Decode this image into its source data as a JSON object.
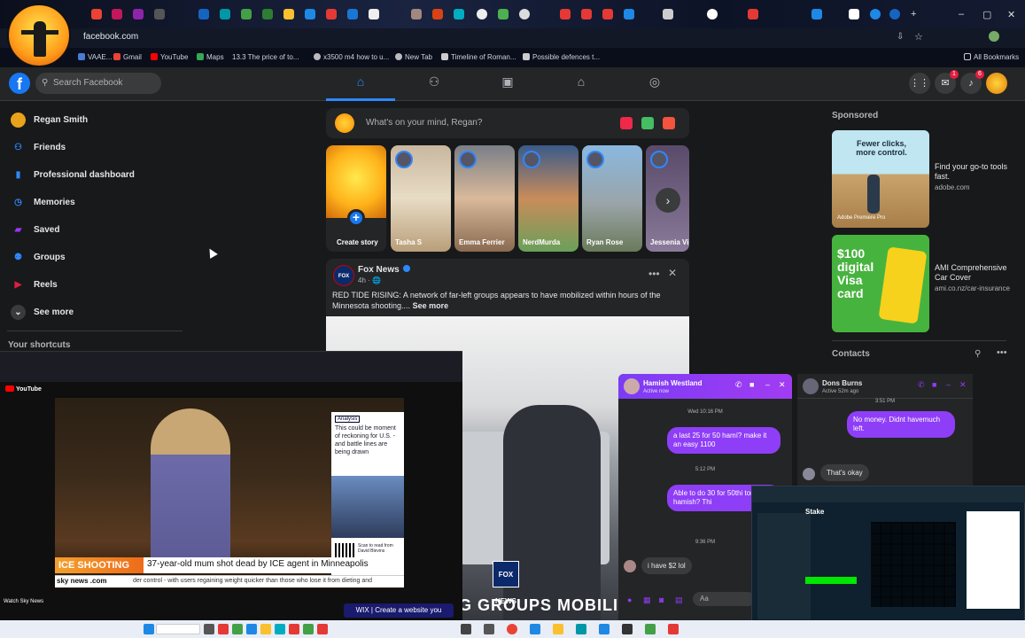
{
  "browser": {
    "url": "facebook.com",
    "bookmarks": [
      {
        "label": "VAAE...",
        "color": "#4a7bd4"
      },
      {
        "label": "Gmail",
        "color": "#ea4335"
      },
      {
        "label": "YouTube",
        "color": "#ff0000"
      },
      {
        "label": "Maps",
        "color": "#34a853"
      },
      {
        "label": "13.3 The price of to...",
        "color": "#6b7bd0"
      },
      {
        "label": "x3500 m4 how to u...",
        "color": "#bbbbbb"
      },
      {
        "label": "New Tab",
        "color": "#bbbbbb"
      },
      {
        "label": "Timeline of Roman...",
        "color": "#cccccc"
      },
      {
        "label": "Possible defences t...",
        "color": "#cccccc"
      }
    ],
    "all_bookmarks": "All Bookmarks",
    "window_controls": [
      "–",
      "▢",
      "✕"
    ]
  },
  "facebook": {
    "logo": "f",
    "search_placeholder": "Search Facebook",
    "header_badges": {
      "messenger": "1",
      "notifications": "6"
    },
    "left_nav": [
      {
        "label": "Regan Smith",
        "icon": "profile-avatar",
        "color": "#e8a21c"
      },
      {
        "label": "Friends",
        "icon": "friends-icon",
        "color": "#1877f2"
      },
      {
        "label": "Professional dashboard",
        "icon": "dashboard-icon",
        "color": "#1877f2"
      },
      {
        "label": "Memories",
        "icon": "clock-icon",
        "color": "#1877f2"
      },
      {
        "label": "Saved",
        "icon": "bookmark-icon",
        "color": "#a033ff"
      },
      {
        "label": "Groups",
        "icon": "groups-icon",
        "color": "#1877f2"
      },
      {
        "label": "Reels",
        "icon": "reels-icon",
        "color": "#e41e3f"
      },
      {
        "label": "See more",
        "icon": "chevron-down-icon",
        "color": "#3a3b3c"
      }
    ],
    "shortcuts_title": "Your shortcuts",
    "composer_placeholder": "What's on your mind, Regan?",
    "stories": [
      {
        "label": "Create story"
      },
      {
        "label": "Tasha S"
      },
      {
        "label": "Emma Ferrier"
      },
      {
        "label": "NerdMurda"
      },
      {
        "label": "Ryan Rose"
      },
      {
        "label": "Jessenia Vi"
      }
    ],
    "post": {
      "author": "Fox News",
      "time": "4h · 🌐",
      "text": "RED TIDE RISING: A network of far-left groups appears to have mobilized within hours of the Minnesota shooting....",
      "see_more": "See more",
      "image_logo": "FOX NEWS",
      "image_caption": "G GROUPS MOBILI"
    },
    "sponsored_title": "Sponsored",
    "ads": [
      {
        "headline": "Fewer clicks, more control.",
        "brand": "Adobe Premiere Pro",
        "title": "Find your go-to tools fast.",
        "domain": "adobe.com"
      },
      {
        "headline": "$100 digital Visa card",
        "title": "AMI Comprehensive Car Cover",
        "domain": "ami.co.nz/car-insurance"
      }
    ],
    "contacts_title": "Contacts"
  },
  "youtube_pip": {
    "logo": "YouTube",
    "side_tag": "Analysis",
    "side_text": "This could be moment of reckoning for U.S. - and battle lines are being drawn",
    "side_scan": "Scan to read from David Blevins",
    "lower_tag": "ICE SHOOTING",
    "headline": "37-year-old mum shot dead by ICE agent in Minneapolis",
    "sky_logo": "sky news .com",
    "ticker": "der control - with users regaining weight quicker than those who lose it from dieting and",
    "channel": "Watch Sky News",
    "ad": "WIX | Create a website you"
  },
  "chat_hamish": {
    "name": "Hamish Westland",
    "status": "Active now",
    "messages": [
      {
        "type": "time",
        "text": "Wed 10:16 PM"
      },
      {
        "type": "out",
        "text": "a last 25 for 50 hamí? make it an easy 1100"
      },
      {
        "type": "time",
        "text": "5:12 PM"
      },
      {
        "type": "out",
        "text": "Able to do 30 for 50thi tomorrow hamish? Thi"
      },
      {
        "type": "time",
        "text": "9:36 PM"
      },
      {
        "type": "in",
        "text": "i have $2 lol"
      }
    ],
    "input_placeholder": "Aa"
  },
  "chat_dons": {
    "name": "Dons Burns",
    "status": "Active 52m ago",
    "messages": [
      {
        "type": "time",
        "text": "3:51 PM"
      },
      {
        "type": "out",
        "text": "No money. Didnt havemuch left."
      },
      {
        "type": "in",
        "text": "That's okay"
      }
    ]
  },
  "stake_overlay": {
    "logo": "Stake"
  }
}
